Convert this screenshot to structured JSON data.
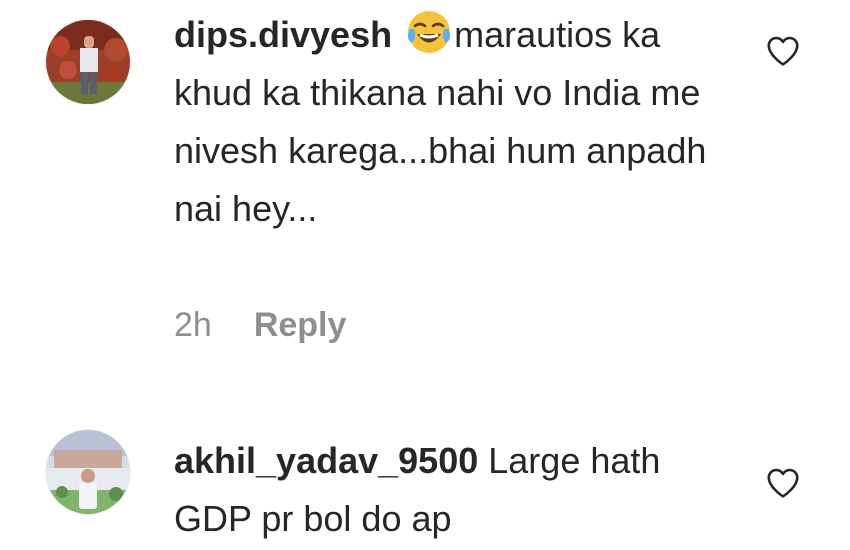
{
  "comments": [
    {
      "username": "dips.divyesh",
      "emoji": "face-with-tears-of-joy",
      "text": "marautios ka khud ka thikana nahi vo India me nivesh karega...bhai hum anpadh nai hey...",
      "time": "2h",
      "reply_label": "Reply",
      "like_icon": "heart-outline-icon"
    },
    {
      "username": "akhil_yadav_9500",
      "text": "Large hath GDP pr bol do ap",
      "like_icon": "heart-outline-icon"
    }
  ],
  "colors": {
    "text": "#262626",
    "muted": "#8e8e8e"
  }
}
